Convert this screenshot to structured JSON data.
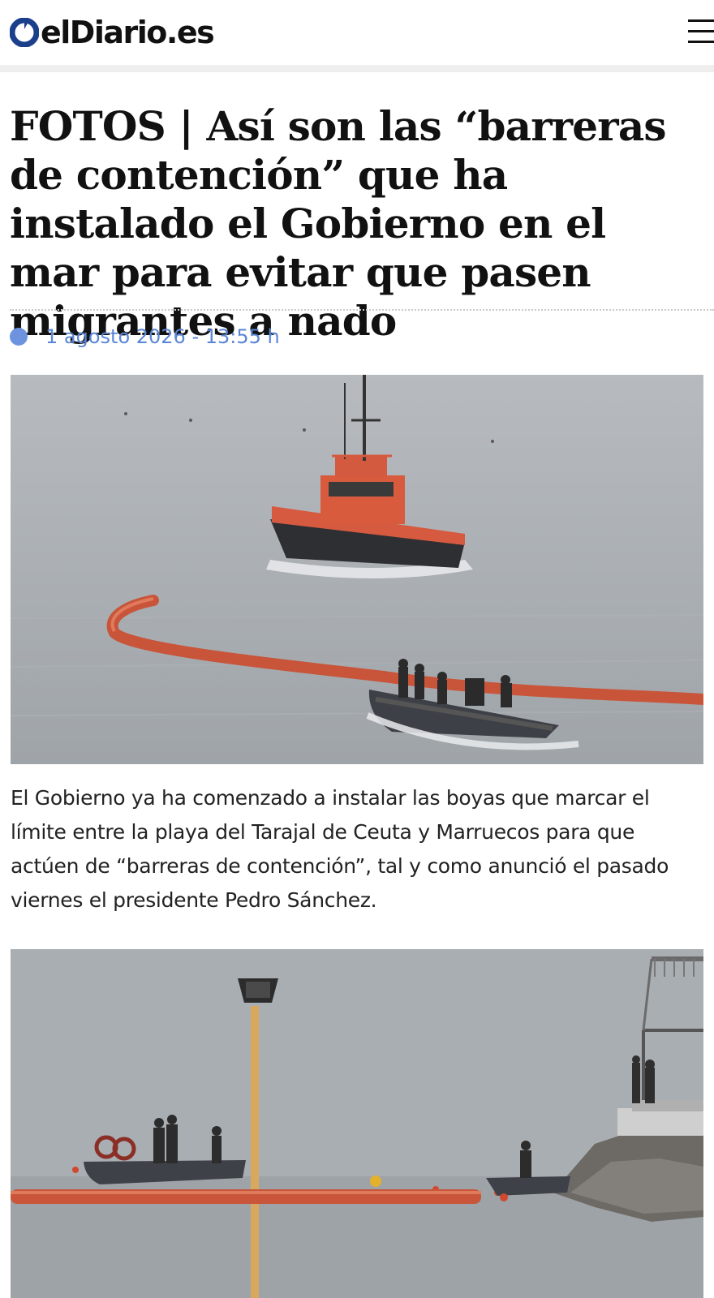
{
  "header": {
    "logo_text": "elDiario.es",
    "menu_icon": "hamburger-menu-icon"
  },
  "article": {
    "headline": "FOTOS | Así son las “barreras de contención” que ha instalado el Gobierno en el mar para evitar que pasen migrantes a nado",
    "date": "1 agosto 2026 - 13:55 h",
    "paragraph": "El Gobierno ya ha comenzado a instalar las boyas que marcar el límite entre la playa del Tarajal de Ceuta y Marruecos para que actúen de “barreras de contención”, tal y como anunció el pasado viernes el presidente Pedro Sánchez."
  },
  "colors": {
    "accent": "#6e93de",
    "date_text": "#5a86d6",
    "logo_mark": "#1c3f8c",
    "boom": "#c8553a",
    "sea": "#a9aeb3"
  }
}
